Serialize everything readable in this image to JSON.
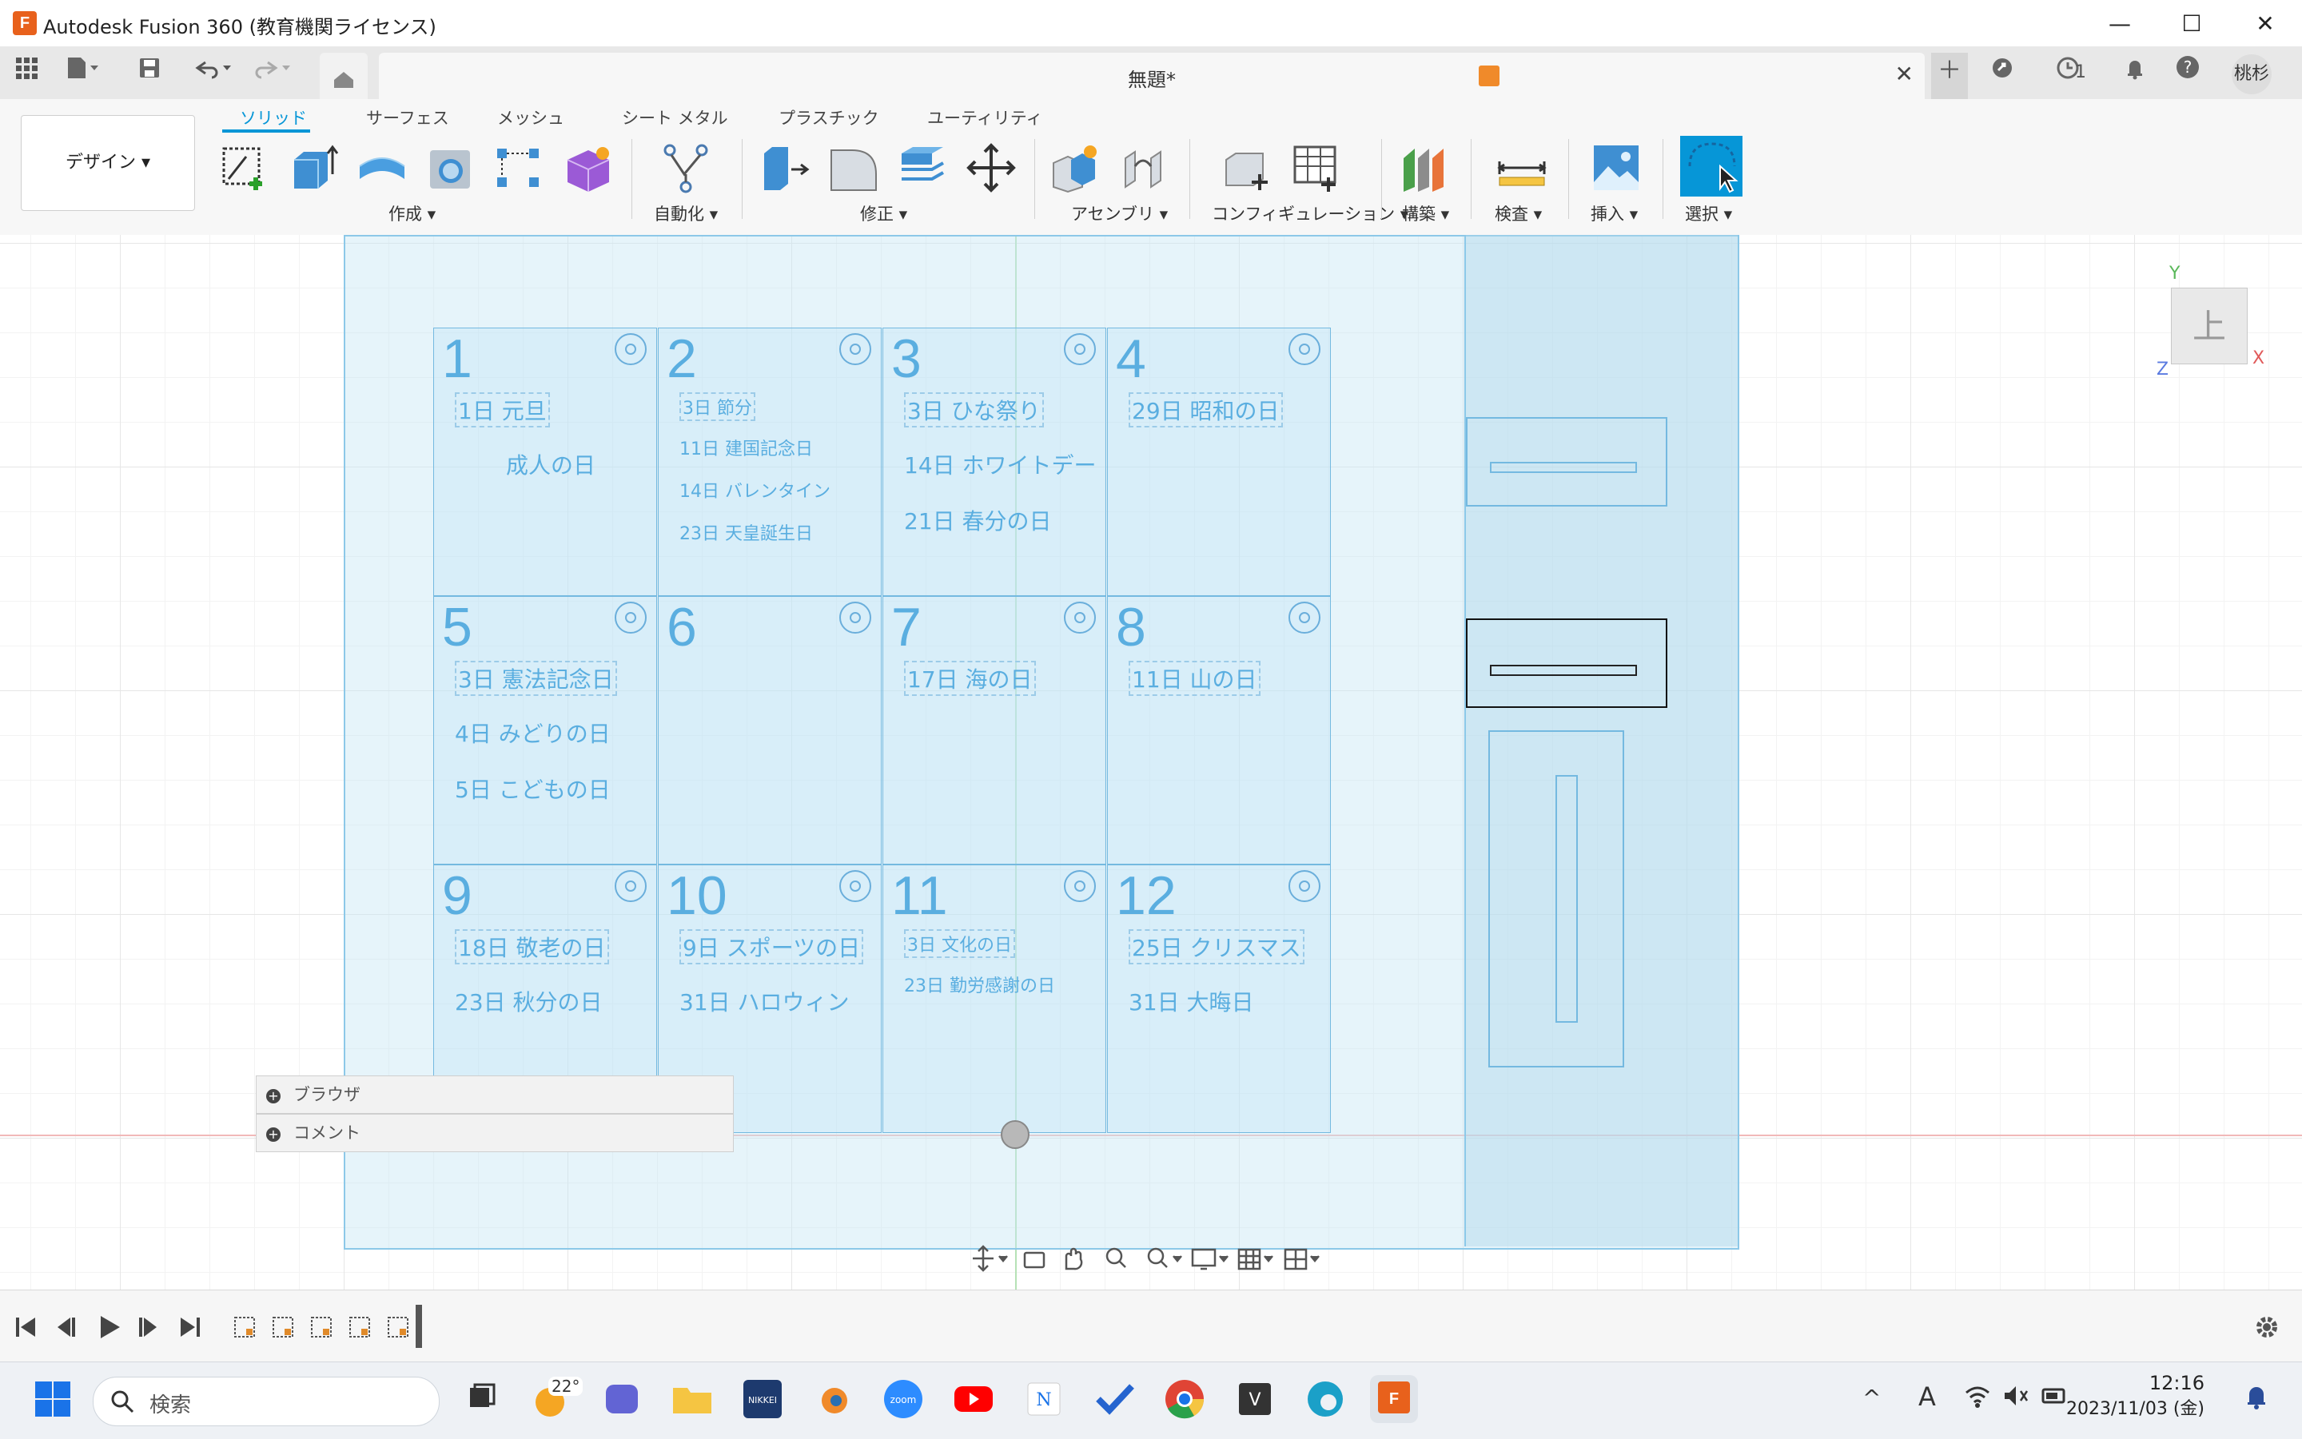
{
  "window": {
    "title": "Autodesk Fusion 360 (教育機関ライセンス)",
    "logo_letter": "F",
    "minimize": "—",
    "maximize": "☐",
    "close": "✕"
  },
  "tabbar": {
    "doc_title": "無題*",
    "job_count": "1",
    "user": "桃杉"
  },
  "toolbar": {
    "workspace": "デザイン ▾",
    "tabs": [
      "ソリッド",
      "サーフェス",
      "メッシュ",
      "シート メタル",
      "プラスチック",
      "ユーティリティ"
    ],
    "groups": [
      "作成 ▾",
      "自動化 ▾",
      "修正 ▾",
      "アセンブリ ▾",
      "コンフィギュレーション ▾",
      "構築 ▾",
      "検査 ▾",
      "挿入 ▾",
      "選択 ▾"
    ]
  },
  "viewcube": {
    "face": "上",
    "x": "X",
    "y": "Y",
    "z": "Z"
  },
  "calendar": [
    {
      "num": "1",
      "items": [
        "1日  元旦",
        "成人の日"
      ]
    },
    {
      "num": "2",
      "items": [
        "3日  節分",
        "11日  建国記念日",
        "14日  バレンタイン",
        "23日  天皇誕生日"
      ]
    },
    {
      "num": "3",
      "items": [
        "3日  ひな祭り",
        "14日  ホワイトデー",
        "21日  春分の日"
      ]
    },
    {
      "num": "4",
      "items": [
        "29日  昭和の日"
      ]
    },
    {
      "num": "5",
      "items": [
        "3日  憲法記念日",
        "4日  みどりの日",
        "5日  こどもの日"
      ]
    },
    {
      "num": "6",
      "items": []
    },
    {
      "num": "7",
      "items": [
        "17日  海の日"
      ]
    },
    {
      "num": "8",
      "items": [
        "11日  山の日"
      ]
    },
    {
      "num": "9",
      "items": [
        "18日  敬老の日",
        "23日  秋分の日"
      ]
    },
    {
      "num": "10",
      "items": [
        "9日  スポーツの日",
        "31日  ハロウィン"
      ]
    },
    {
      "num": "11",
      "items": [
        "3日  文化の日",
        "23日  勤労感謝の日"
      ]
    },
    {
      "num": "12",
      "items": [
        "25日  クリスマス",
        "31日  大晦日"
      ]
    }
  ],
  "panels": {
    "browser": "ブラウザ",
    "comment": "コメント"
  },
  "taskbar": {
    "search_placeholder": "検索",
    "weather": "22°",
    "time": "12:16",
    "date": "2023/11/03 (金)",
    "ime": "A"
  }
}
